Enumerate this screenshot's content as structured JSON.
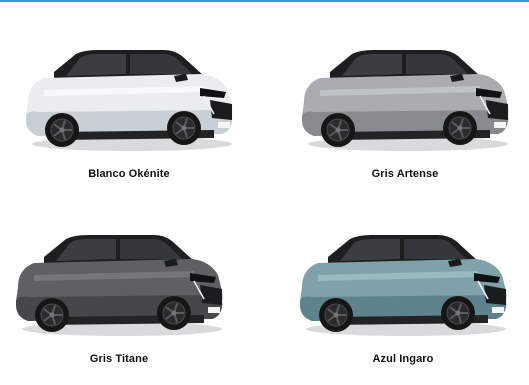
{
  "colors": {
    "accent_rule": "#1aa3d9"
  },
  "cars": [
    {
      "label": "Blanco Okénite",
      "body": "#e9edf0",
      "shade": "#c9d0d5",
      "highlight": "#fbfcfd"
    },
    {
      "label": "Gris Artense",
      "body": "#a9adb2",
      "shade": "#878b90",
      "highlight": "#c8ccd0"
    },
    {
      "label": "Gris Titane",
      "body": "#5e6064",
      "shade": "#45474a",
      "highlight": "#7e8084"
    },
    {
      "label": "Azul Ingaro",
      "body": "#7fa2aa",
      "shade": "#5f838c",
      "highlight": "#a7c3ca"
    }
  ]
}
